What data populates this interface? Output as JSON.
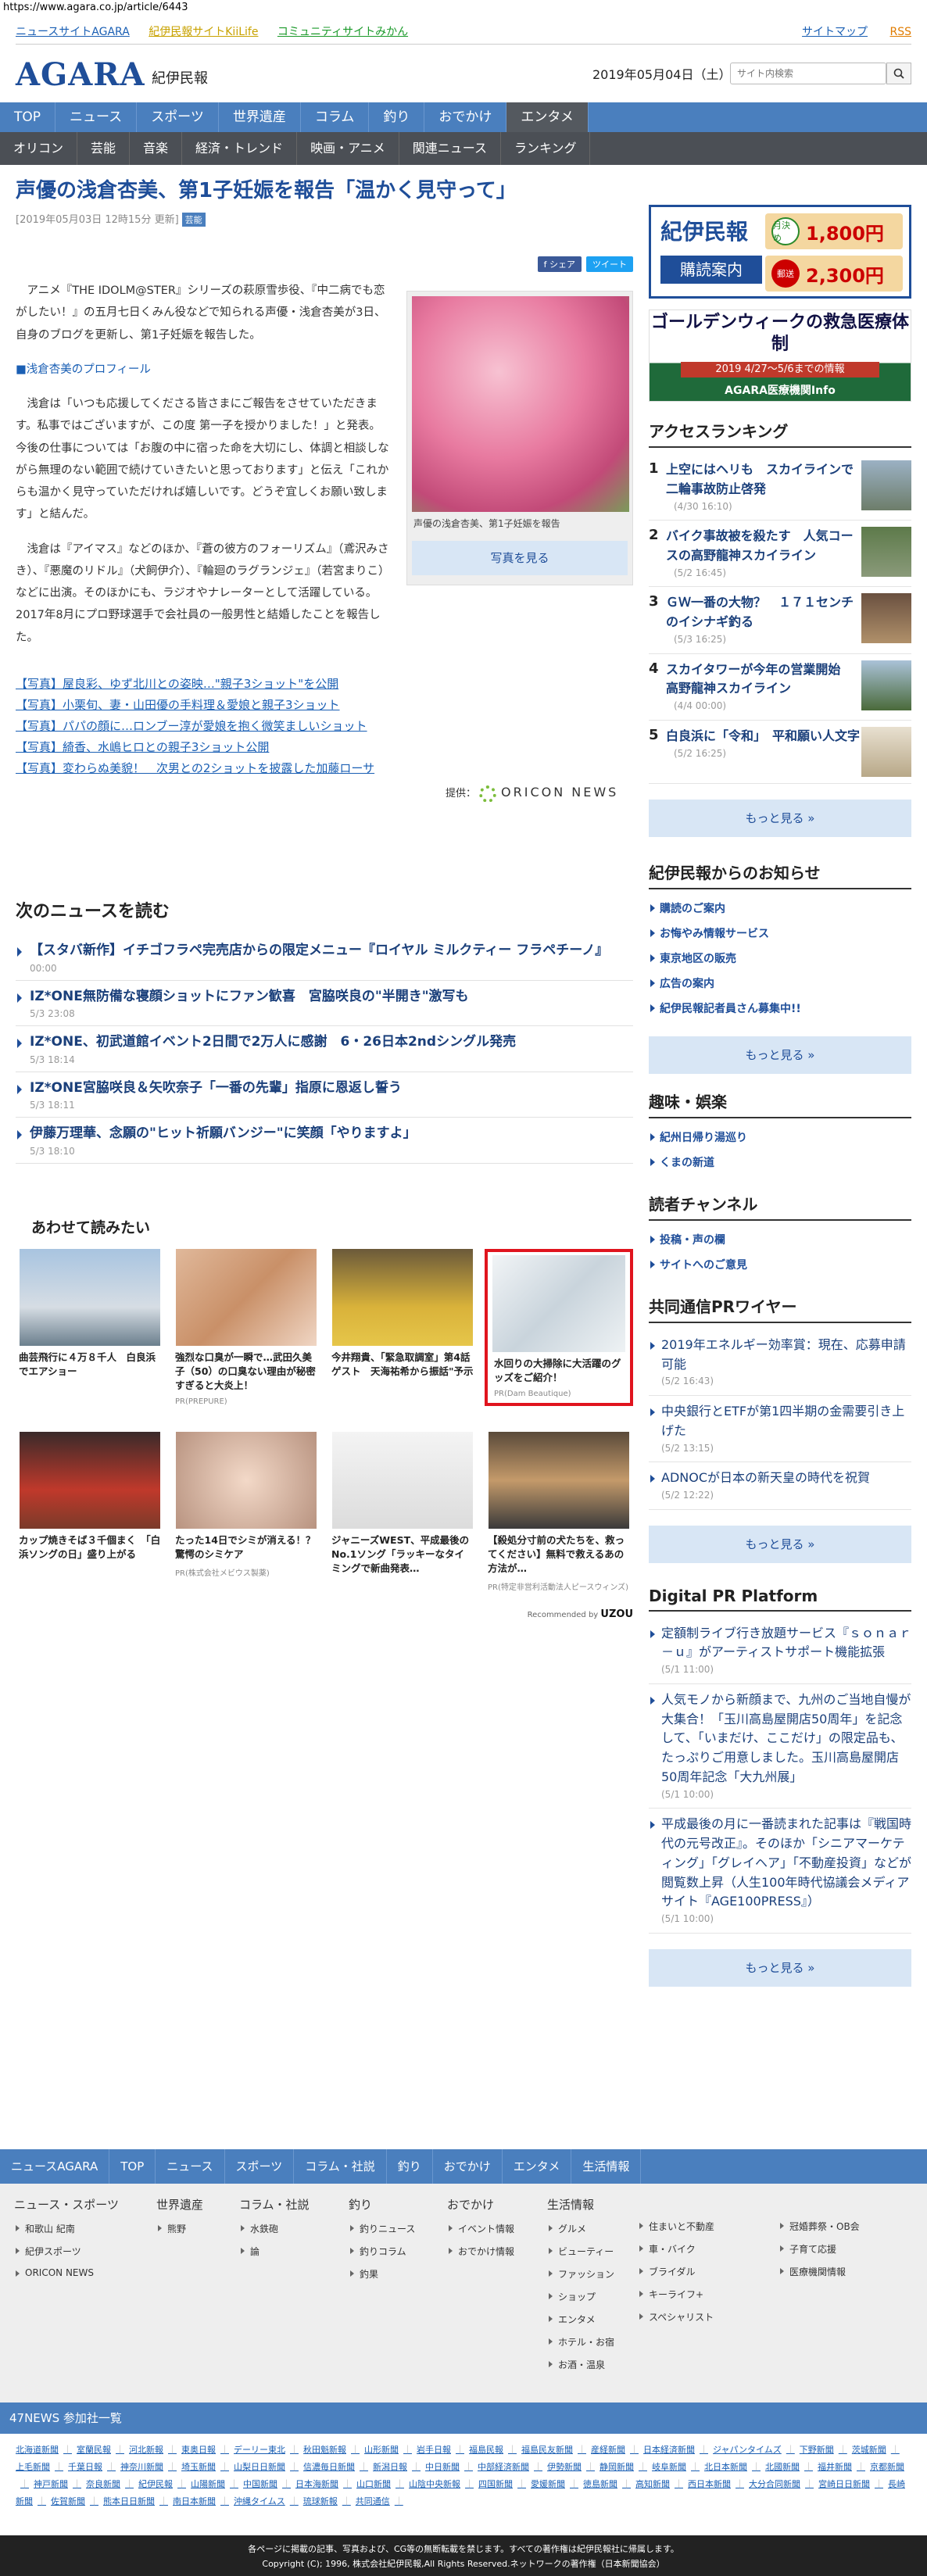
{
  "url": "https://www.agara.co.jp/article/6443",
  "toplinks": {
    "left": [
      "ニュースサイトAGARA",
      "紀伊民報サイトKiiLife",
      "コミュニティサイトみかん"
    ],
    "right": [
      "サイトマップ",
      "RSS"
    ]
  },
  "header": {
    "logo": "AGARA",
    "logo_sub": "紀伊民報",
    "date": "2019年05月04日（土）",
    "search_placeholder": "サイト内検索"
  },
  "nav1": [
    "TOP",
    "ニュース",
    "スポーツ",
    "世界遺産",
    "コラム",
    "釣り",
    "おでかけ",
    "エンタメ"
  ],
  "nav2": [
    "オリコン",
    "芸能",
    "音楽",
    "経済・トレンド",
    "映画・アニメ",
    "関連ニュース",
    "ランキング"
  ],
  "article": {
    "title": "声優の浅倉杏美、第1子妊娠を報告「温かく見守って」",
    "meta": "[2019年05月03日 12時15分 更新]",
    "badge": "芸能",
    "share_fb": "f シェア",
    "share_tw": "ツイート",
    "p1": "アニメ『THE IDOLM@STER』シリーズの萩原雪歩役、『中二病でも恋がしたい！』の五月七日くみん役などで知られる声優・浅倉杏美が3日、自身のブログを更新し、第1子妊娠を報告した。",
    "link": "■浅倉杏美のプロフィール",
    "p2": "浅倉は「いつも応援してくださる皆さまにご報告をさせていただきます。私事ではございますが、この度 第一子を授かりました！」と発表。今後の仕事については「お腹の中に宿った命を大切にし、体調と相談しながら無理のない範囲で続けていきたいと思っております」と伝え「これからも温かく見守っていただければ嬉しいです。どうぞ宜しくお願い致します」と結んだ。",
    "p3": "浅倉は『アイマス』などのほか、『蒼の彼方のフォーリズム』（鳶沢みさき）、『悪魔のリドル』（犬飼伊介）、『輪廻のラグランジェ』（若宮まりこ）などに出演。そのほかにも、ラジオやナレーターとして活躍している。2017年8月にプロ野球選手で会社員の一般男性と結婚したことを報告した。",
    "photo_caption": "声優の浅倉杏美、第1子妊娠を報告",
    "photo_button": "写真を見る",
    "related": [
      "【写真】屋良彩、ゆず北川との姿映…\"親子3ショット\"を公開",
      "【写真】小栗旬、妻・山田優の手料理＆愛娘と親子3ショット",
      "【写真】パパの顔に…ロンブー淳が愛娘を抱く微笑ましいショット",
      "【写真】綺香、水嶋ヒロとの親子3ショット公開",
      "【写真】変わらぬ美貌！　次男との2ショットを披露した加藤ローサ"
    ],
    "provider_label": "提供：",
    "provider_name": "ORICON NEWS"
  },
  "next_news": {
    "heading": "次のニュースを読む",
    "items": [
      {
        "title": "【スタバ新作】イチゴフラペ完売店からの限定メニュー『ロイヤル ミルクティー フラペチーノ』",
        "date": "00:00"
      },
      {
        "title": "IZ*ONE無防備な寝顔ショットにファン歓喜　宮脇咲良の\"半開き\"激写も",
        "date": "5/3 23:08"
      },
      {
        "title": "IZ*ONE、初武道館イベント2日間で2万人に感謝　6・26日本2ndシングル発売",
        "date": "5/3 18:14"
      },
      {
        "title": "IZ*ONE宮脇咲良＆矢吹奈子「一番の先輩」指原に恩返し誓う",
        "date": "5/3 18:11"
      },
      {
        "title": "伊藤万理華、念願の\"ヒット祈願バンジー\"に笑顔「やりますよ」",
        "date": "5/3 18:10"
      }
    ]
  },
  "recommend": {
    "heading": "あわせて読みたい",
    "row1": [
      {
        "title": "曲芸飛行に４万８千人　白良浜でエアショー",
        "pr": ""
      },
      {
        "title": "強烈な口臭が一瞬で…武田久美子（50）の口臭ない理由が秘密すぎると大炎上！",
        "pr": "PR(PREPURE)"
      },
      {
        "title": "今井翔貴、「緊急取調室」第4話ゲスト　天海祐希から振話\"予示",
        "pr": ""
      },
      {
        "title": "水回りの大掃除に大活躍のグッズをご紹介！",
        "pr": "PR(Dam Beautique)"
      }
    ],
    "row2": [
      {
        "title": "カップ焼きそば３千個まく　「白浜ソングの日」盛り上がる",
        "pr": ""
      },
      {
        "title": "たった14日でシミが消える！？驚愕のシミケア",
        "pr": "PR(株式会社メビウス製薬)"
      },
      {
        "title": "ジャニーズWEST、平成最後のNo.1ソング「ラッキーなタイミングで新曲発表…",
        "pr": ""
      },
      {
        "title": "【殺処分寸前の犬たちを、救ってください】無料で救えるあの方法が…",
        "pr": "PR(特定非営利活動法人ピースウィンズ)"
      }
    ],
    "recommended_by": "Recommended by",
    "recommended_brand": "UZOU"
  },
  "sidebar": {
    "ad1_logo": "紀伊民報",
    "ad1_sub": "購読案内",
    "ad1_monthly_label": "月決め",
    "ad1_monthly_price": "1,800円",
    "ad1_mail_label": "郵送",
    "ad1_mail_price": "2,300円",
    "ad2_title": "ゴールデンウィークの救急医療体制",
    "ad2_sub": "2019 4/27〜5/6までの情報",
    "ad2_brand": "AGARA医療機関Info",
    "ranking_heading": "アクセスランキング",
    "ranking": [
      {
        "n": "1",
        "title": "上空にはヘリも　スカイラインで二輪事故防止啓発",
        "date": "(4/30 16:10)"
      },
      {
        "n": "2",
        "title": "バイク事故被を殺たす　人気コースの高野龍神スカイライン",
        "date": "(5/2 16:45)"
      },
      {
        "n": "3",
        "title": "ＧＷ一番の大物？　１７１センチのイシナギ釣る",
        "date": "(5/3 16:25)"
      },
      {
        "n": "4",
        "title": "スカイタワーが今年の営業開始　高野龍神スカイライン",
        "date": "(4/4 00:00)"
      },
      {
        "n": "5",
        "title": "白良浜に「令和」　平和願い人文字",
        "date": "(5/2 16:25)"
      }
    ],
    "more": "もっと見る »",
    "notice_heading": "紀伊民報からのお知らせ",
    "notices": [
      "購読のご案内",
      "お悔やみ情報サービス",
      "東京地区の販売",
      "広告の案内",
      "紀伊民報記者員さん募集中!!"
    ],
    "hobby_heading": "趣味・娯楽",
    "hobby": [
      "紀州日帰り湯巡り",
      "くまの新道"
    ],
    "reader_heading": "読者チャンネル",
    "reader": [
      "投稿・声の欄",
      "サイトへのご意見"
    ],
    "kyodo_heading": "共同通信PRワイヤー",
    "kyodo": [
      {
        "title": "2019年エネルギー効率賞：現在、応募申請可能",
        "date": "(5/2 16:43)"
      },
      {
        "title": "中央銀行とETFが第1四半期の金需要引き上げた",
        "date": "(5/2 13:15)"
      },
      {
        "title": "ADNOCが日本の新天皇の時代を祝賀",
        "date": "(5/2 12:22)"
      }
    ],
    "dpr_heading": "Digital PR Platform",
    "dpr": [
      {
        "title": "定額制ライブ行き放題サービス『ｓｏｎａｒ－ｕ』がアーティストサポート機能拡張",
        "date": "(5/1 11:00)"
      },
      {
        "title": "人気モノから新顔まで、九州のご当地自慢が大集合！「玉川高島屋開店50周年」を記念して、「いまだけ、ここだけ」の限定品も、たっぷりご用意しました。玉川高島屋開店50周年記念「大九州展」",
        "date": "(5/1 10:00)"
      },
      {
        "title": "平成最後の月に一番読まれた記事は『戦国時代の元号改正』。そのほか「シニアマーケティング」「グレイヘア」「不動産投資」などが閲覧数上昇（人生100年時代協議会メディアサイト『AGE100PRESS』）",
        "date": "(5/1 10:00)"
      }
    ]
  },
  "footer": {
    "nav": [
      "ニュースAGARA",
      "TOP",
      "ニュース",
      "スポーツ",
      "コラム・社説",
      "釣り",
      "おでかけ",
      "エンタメ",
      "生活情報"
    ],
    "cols": [
      {
        "h": "ニュース・スポーツ",
        "items": [
          "和歌山 紀南",
          "紀伊スポーツ",
          "ORICON NEWS"
        ]
      },
      {
        "h": "世界遺産",
        "items": [
          "熊野"
        ]
      },
      {
        "h": "コラム・社説",
        "items": [
          "水鉄砲",
          "論"
        ]
      },
      {
        "h": "釣り",
        "items": [
          "釣りニュース",
          "釣りコラム",
          "釣果"
        ]
      },
      {
        "h": "おでかけ",
        "items": [
          "イベント情報",
          "おでかけ情報"
        ]
      },
      {
        "h": "生活情報",
        "items": [
          "グルメ",
          "ビューティー",
          "ファッション",
          "ショップ",
          "エンタメ",
          "ホテル・お宿",
          "お酒・温泉"
        ]
      },
      {
        "h": "",
        "items": [
          "住まいと不動産",
          "車・バイク",
          "ブライダル",
          "キーライフ+",
          "スペシャリスト"
        ]
      },
      {
        "h": "",
        "items": [
          "冠婚葬祭・OB会",
          "子育て応援",
          "医療機関情報"
        ]
      }
    ],
    "n47": "47NEWS 参加社一覧",
    "papers": [
      "北海道新聞",
      "室蘭民報",
      "河北新報",
      "東奥日報",
      "デーリー東北",
      "秋田魁新報",
      "山形新聞",
      "岩手日報",
      "福島民報",
      "福島民友新聞",
      "産経新聞",
      "日本経済新聞",
      "ジャパンタイムズ",
      "下野新聞",
      "茨城新聞",
      "上毛新聞",
      "千葉日報",
      "神奈川新聞",
      "埼玉新聞",
      "山梨日日新聞",
      "信濃毎日新聞",
      "新潟日報",
      "中日新聞",
      "中部経済新聞",
      "伊勢新聞",
      "静岡新聞",
      "岐阜新聞",
      "北日本新聞",
      "北國新聞",
      "福井新聞",
      "京都新聞",
      "神戸新聞",
      "奈良新聞",
      "紀伊民報",
      "山陽新聞",
      "中国新聞",
      "日本海新聞",
      "山口新聞",
      "山陰中央新報",
      "四国新聞",
      "愛媛新聞",
      "徳島新聞",
      "高知新聞",
      "西日本新聞",
      "大分合同新聞",
      "宮崎日日新聞",
      "長崎新聞",
      "佐賀新聞",
      "熊本日日新聞",
      "南日本新聞",
      "沖縄タイムス",
      "琉球新報",
      "共同通信"
    ],
    "copy1": "各ページに掲載の記事、写真および、CG等の無断転載を禁じます。すべての著作権は紀伊民報社に帰属します。",
    "copy2": "Copyright (C); 1996, 株式会社紀伊民報,All Rights Reserved.ネットワークの著作権（日本新聞協会）"
  }
}
